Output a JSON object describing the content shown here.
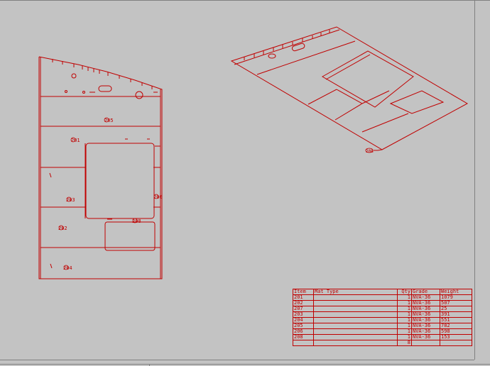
{
  "drawing": {
    "line_color": "#c00000",
    "background_color": "#c3c3c3",
    "part_labels_front": [
      "205",
      "201",
      "203",
      "202",
      "204",
      "208",
      "206"
    ],
    "part_labels_iso": [
      "208"
    ]
  },
  "bom": {
    "headers": {
      "item": "Item",
      "material_type": "Mat Type",
      "qty": "Qty",
      "grade": "Grade",
      "weight": "Weight"
    },
    "rows": [
      {
        "item": "201",
        "qty": "1",
        "grade": "NVA-36",
        "weight": "1079"
      },
      {
        "item": "202",
        "qty": "1",
        "grade": "NVA-36",
        "weight": "507"
      },
      {
        "item": "207",
        "qty": "1",
        "grade": "NVA-36",
        "weight": "25"
      },
      {
        "item": "203",
        "qty": "1",
        "grade": "NVA-36",
        "weight": "391"
      },
      {
        "item": "204",
        "qty": "1",
        "grade": "NVA-36",
        "weight": "551"
      },
      {
        "item": "205",
        "qty": "1",
        "grade": "NVA-36",
        "weight": "782"
      },
      {
        "item": "206",
        "qty": "1",
        "grade": "NVA-36",
        "weight": "598"
      },
      {
        "item": "208",
        "qty": "1",
        "grade": "NVA-36",
        "weight": "153"
      }
    ],
    "total_qty": "8"
  }
}
